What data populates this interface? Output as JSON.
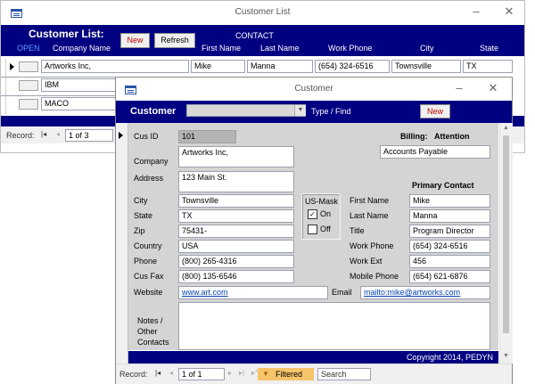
{
  "list": {
    "title": "Customer List",
    "header_title": "Customer List:",
    "new_label": "New",
    "refresh_label": "Refresh",
    "contact_header": "CONTACT",
    "columns": {
      "open": "OPEN",
      "company": "Company Name",
      "first": "First Name",
      "last": "Last Name",
      "phone": "Work Phone",
      "city": "City",
      "state": "State"
    },
    "rows": [
      {
        "company": "Artworks Inc,",
        "first": "Mike",
        "last": "Manna",
        "phone": "(654) 324-6516",
        "city": "Townsville",
        "state": "TX"
      },
      {
        "company": "IBM"
      },
      {
        "company": "MACO"
      }
    ],
    "record_label": "Record:",
    "record_value": "1 of 3"
  },
  "customer": {
    "title": "Customer",
    "header_label": "Customer",
    "type_find_label": "Type / Find",
    "combo_value": "",
    "new_label": "New",
    "billing_label": "Billing:",
    "attention_label": "Attention",
    "billing_attention": "Accounts Payable",
    "primary_contact_label": "Primary Contact",
    "fields": {
      "cus_id": {
        "label": "Cus ID",
        "value": "101"
      },
      "company": {
        "label": "Company",
        "value": "Artworks Inc,"
      },
      "address": {
        "label": "Address",
        "value": "123 Main St."
      },
      "city": {
        "label": "City",
        "value": "Townsville"
      },
      "state": {
        "label": "State",
        "value": "TX"
      },
      "zip": {
        "label": "Zip",
        "value": "75431-"
      },
      "country": {
        "label": "Country",
        "value": "USA"
      },
      "phone": {
        "label": "Phone",
        "value": "(800) 265-4316"
      },
      "cus_fax": {
        "label": "Cus Fax",
        "value": "(800) 135-6546"
      },
      "website": {
        "label": "Website",
        "value": "www.art.com"
      },
      "email": {
        "label": "Email",
        "value": "mailto:mike@artworks.com"
      },
      "notes": {
        "label_1": "Notes /",
        "label_2": "Other",
        "label_3": "Contacts",
        "value": ""
      }
    },
    "usmask": {
      "label": "US-Mask",
      "on_label": "On",
      "off_label": "Off",
      "on_checked": true,
      "off_checked": false
    },
    "contact": {
      "first_name": {
        "label": "First Name",
        "value": "Mike"
      },
      "last_name": {
        "label": "Last Name",
        "value": "Manna"
      },
      "title": {
        "label": "Title",
        "value": "Program Director"
      },
      "work_phone": {
        "label": "Work Phone",
        "value": "(654) 324-6516"
      },
      "work_ext": {
        "label": "Work Ext",
        "value": "456"
      },
      "mobile_phone": {
        "label": "Mobile Phone",
        "value": "(654) 621-6876"
      }
    },
    "copyright": "Copyright 2014, PEDYN",
    "record_label": "Record:",
    "record_value": "1 of 1",
    "filtered_label": "Filtered",
    "search_placeholder": "Search"
  },
  "colors": {
    "navy": "#000080",
    "form_gray": "#d4d4d4",
    "new_button_text": "#c00000"
  }
}
